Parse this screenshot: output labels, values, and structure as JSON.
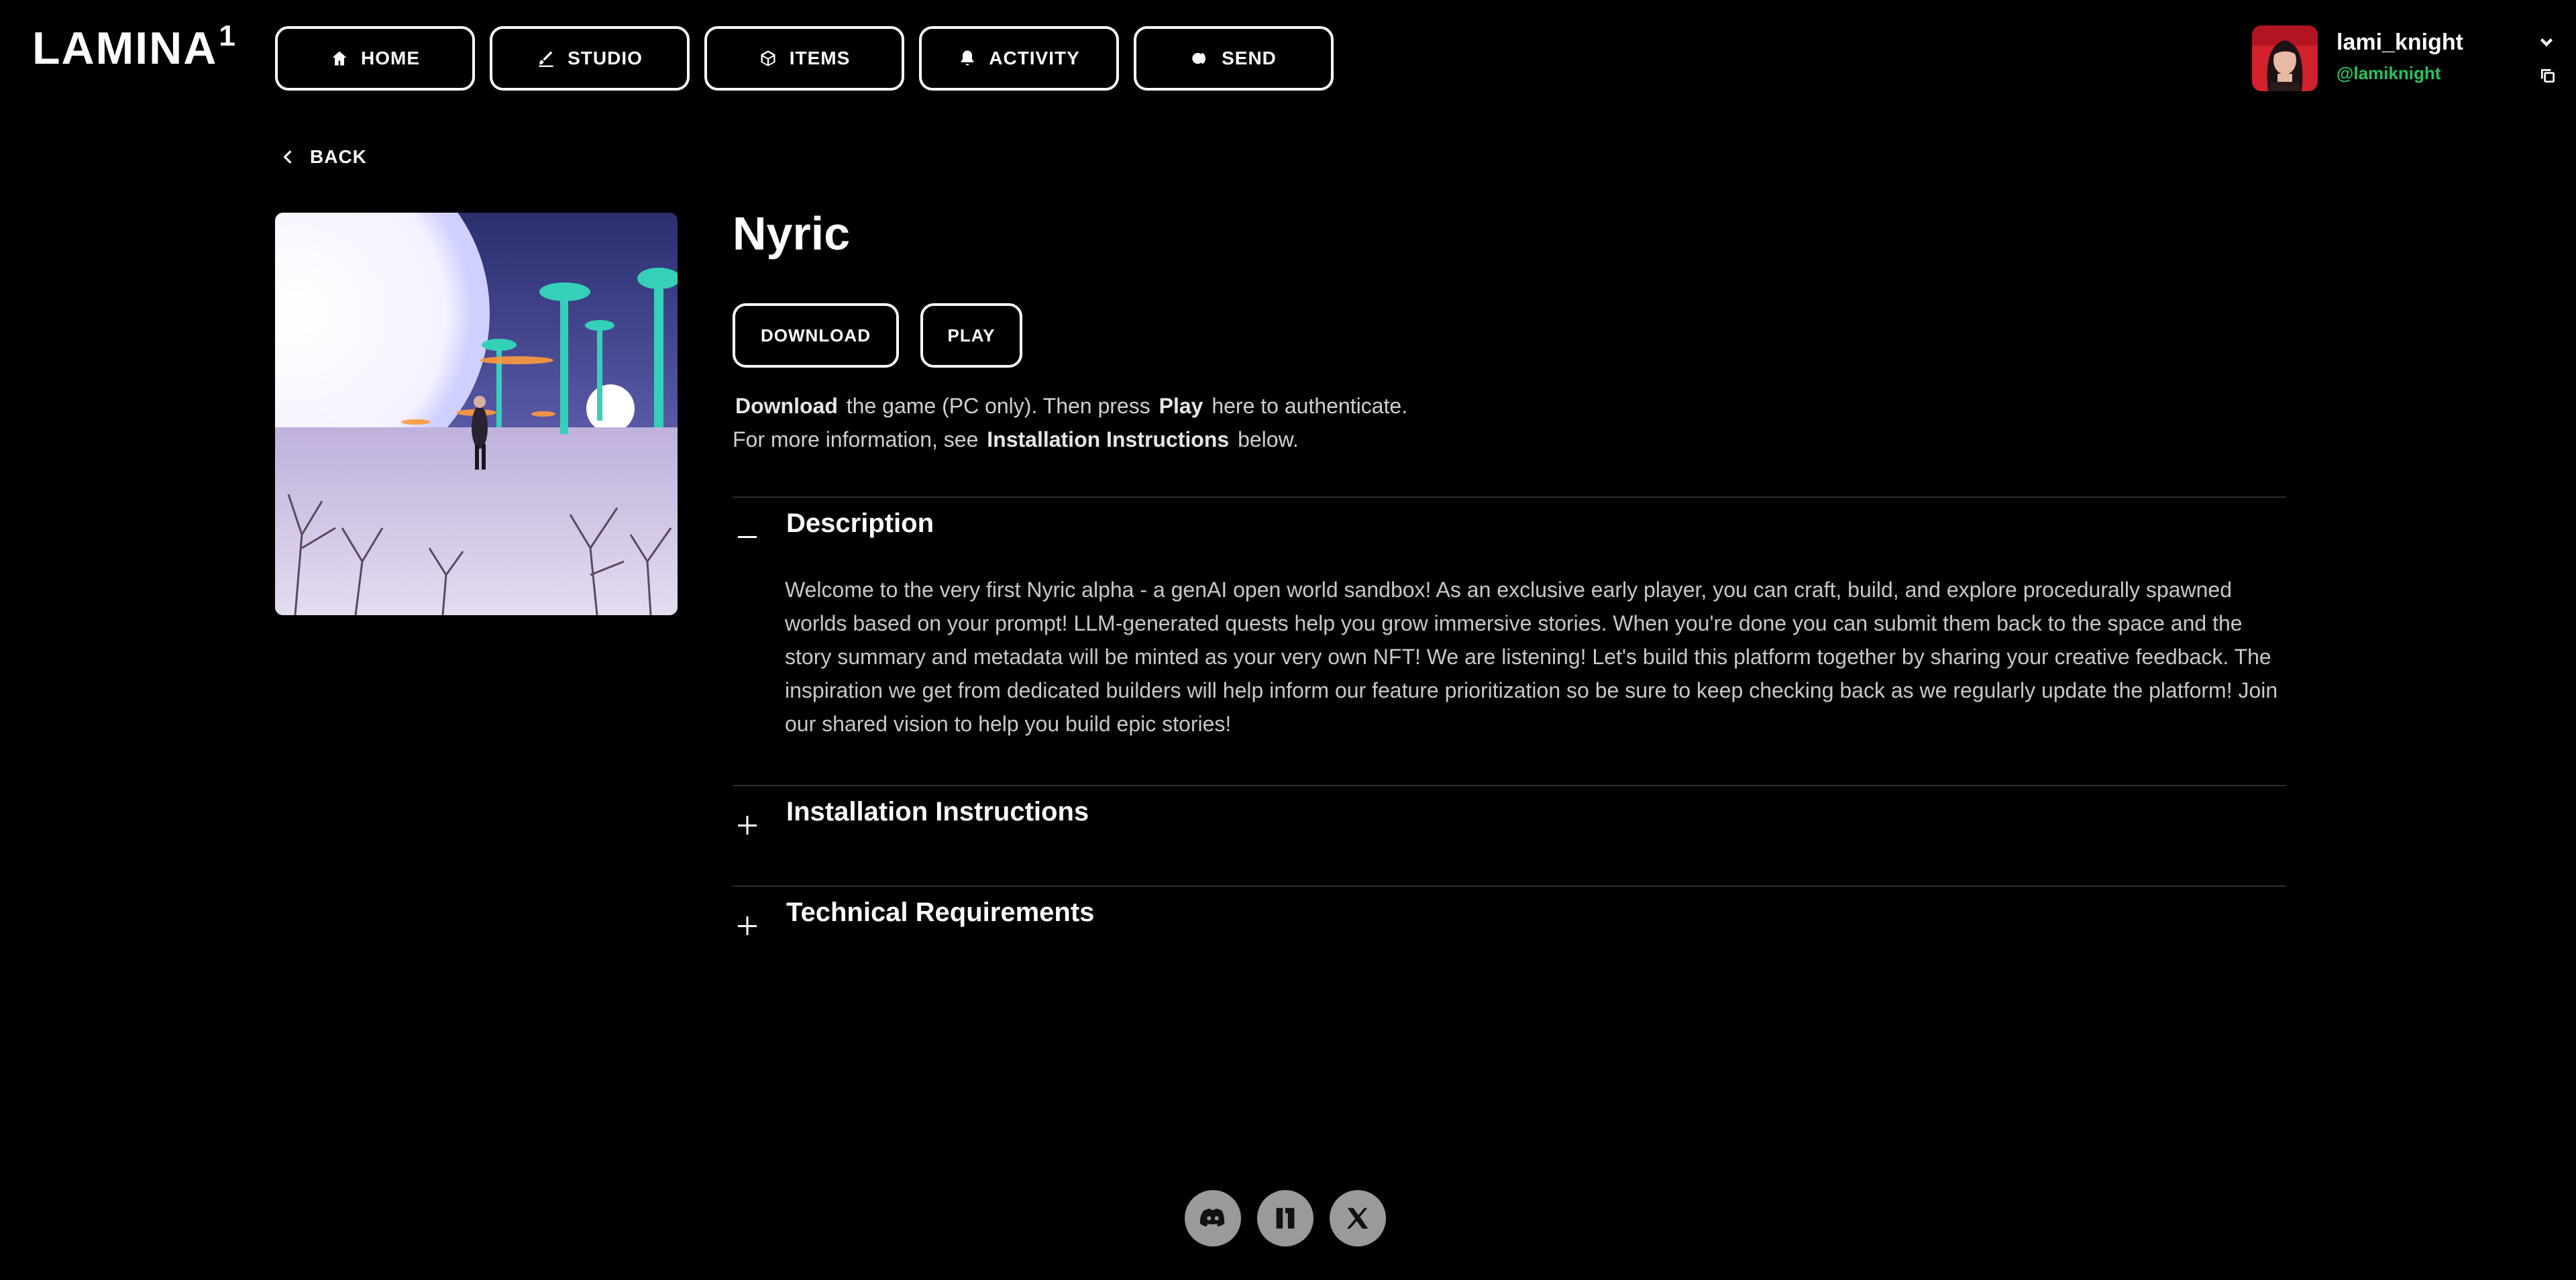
{
  "header": {
    "logo_text": "LAMINA",
    "logo_superscript": "1",
    "nav": [
      {
        "label": "HOME",
        "icon": "home-icon"
      },
      {
        "label": "STUDIO",
        "icon": "studio-icon"
      },
      {
        "label": "ITEMS",
        "icon": "cube-icon"
      },
      {
        "label": "ACTIVITY",
        "icon": "bell-icon"
      },
      {
        "label": "SEND",
        "icon": "send-icon"
      }
    ],
    "user": {
      "name": "lami_knight",
      "handle": "@lamiknight"
    }
  },
  "page": {
    "back_label": "BACK",
    "title": "Nyric",
    "download_label": "DOWNLOAD",
    "play_label": "PLAY",
    "instructions": {
      "line1_bold1": "Download",
      "line1_text1": "the game (PC only). Then press",
      "line1_bold2": "Play",
      "line1_text2": "here to authenticate.",
      "line2_text1": "For more information, see",
      "line2_bold": "Installation Instructions",
      "line2_text2": "below."
    }
  },
  "sections": [
    {
      "label": "Description",
      "expanded": true,
      "body": "Welcome to the very first Nyric alpha - a genAI open world sandbox! As an exclusive early player, you can craft, build, and explore procedurally spawned worlds based on your prompt! LLM-generated quests help you grow immersive stories. When you're done you can submit them back to the space and the story summary and metadata will be minted as your very own NFT! We are listening! Let's build this platform together by sharing your creative feedback. The inspiration we get from dedicated builders will help inform our feature prioritization so be sure to keep checking back as we regularly update the platform! Join our shared vision to help you build epic stories!"
    },
    {
      "label": "Installation Instructions",
      "expanded": false
    },
    {
      "label": "Technical Requirements",
      "expanded": false
    }
  ],
  "footer": {
    "social": [
      "discord-icon",
      "lamina1-icon",
      "x-icon"
    ]
  },
  "colors": {
    "background": "#000000",
    "accent_green": "#22c55e",
    "text": "#ffffff"
  }
}
